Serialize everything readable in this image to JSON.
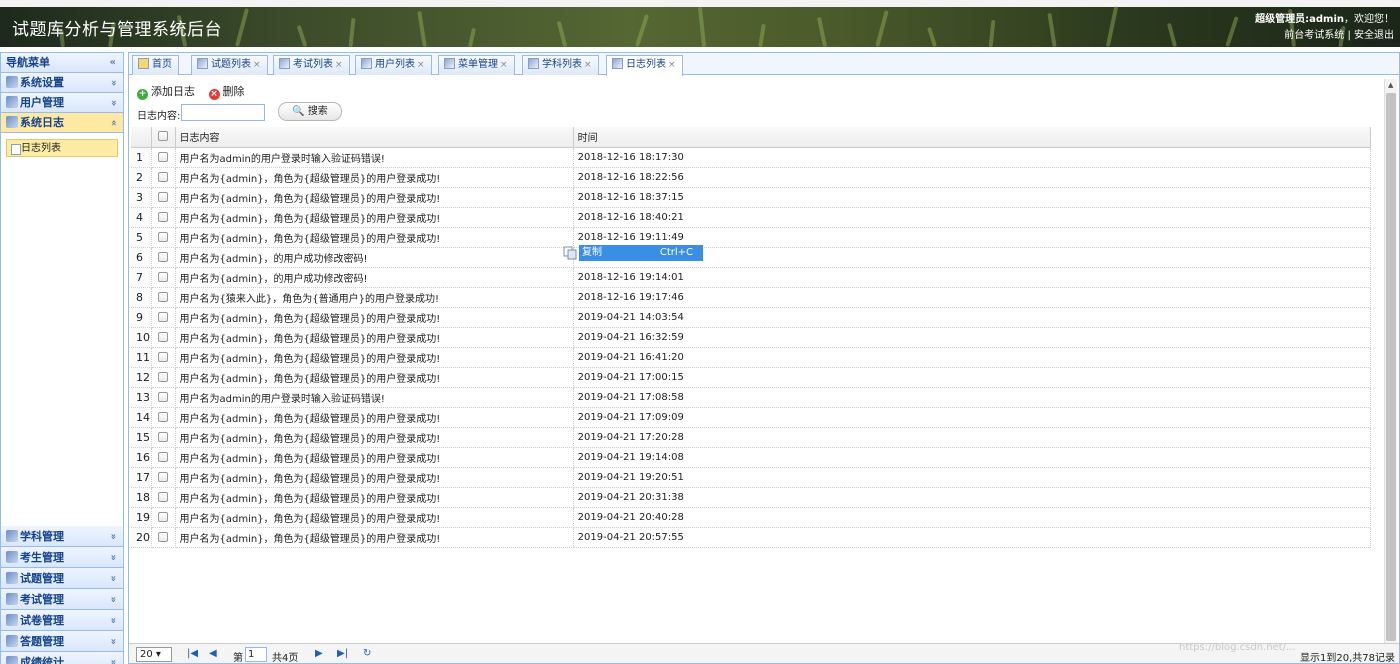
{
  "header": {
    "title": "试题库分析与管理系统后台",
    "user_label": "超级管理员:admin",
    "welcome": "，欢迎您！",
    "front_link": "前台考试系统",
    "separator": "|",
    "logout_link": "安全退出"
  },
  "sidebar": {
    "title": "导航菜单",
    "collapse_icon": "«",
    "groups_top": [
      {
        "label": "系统设置",
        "icon": "tools-icon",
        "arrow": "»"
      },
      {
        "label": "用户管理",
        "icon": "users-icon",
        "arrow": "»"
      },
      {
        "label": "系统日志",
        "icon": "log-icon",
        "arrow": "«",
        "active": true
      }
    ],
    "active_sub": "日志列表",
    "groups_bottom": [
      {
        "label": "学科管理",
        "icon": "list-icon"
      },
      {
        "label": "考生管理",
        "icon": "students-icon"
      },
      {
        "label": "试题管理",
        "icon": "calendar-icon"
      },
      {
        "label": "考试管理",
        "icon": "exam-icon"
      },
      {
        "label": "试卷管理",
        "icon": "paper-icon"
      },
      {
        "label": "答题管理",
        "icon": "answer-icon"
      },
      {
        "label": "成绩统计",
        "icon": "stats-icon"
      }
    ]
  },
  "tabs": [
    {
      "label": "首页",
      "closable": false
    },
    {
      "label": "试题列表",
      "closable": true
    },
    {
      "label": "考试列表",
      "closable": true
    },
    {
      "label": "用户列表",
      "closable": true
    },
    {
      "label": "菜单管理",
      "closable": true
    },
    {
      "label": "学科列表",
      "closable": true
    },
    {
      "label": "日志列表",
      "closable": true,
      "active": true
    }
  ],
  "toolbar": {
    "add_label": "添加日志",
    "delete_label": "删除"
  },
  "search": {
    "label": "日志内容:",
    "value": "",
    "button": "搜索"
  },
  "grid": {
    "columns": [
      "日志内容",
      "时间"
    ],
    "rows": [
      {
        "n": "1",
        "content": "用户名为admin的用户登录时输入验证码错误!",
        "time": "2018-12-16 18:17:30"
      },
      {
        "n": "2",
        "content": "用户名为{admin}，角色为{超级管理员}的用户登录成功!",
        "time": "2018-12-16 18:22:56"
      },
      {
        "n": "3",
        "content": "用户名为{admin}，角色为{超级管理员}的用户登录成功!",
        "time": "2018-12-16 18:37:15"
      },
      {
        "n": "4",
        "content": "用户名为{admin}，角色为{超级管理员}的用户登录成功!",
        "time": "2018-12-16 18:40:21"
      },
      {
        "n": "5",
        "content": "用户名为{admin}，角色为{超级管理员}的用户登录成功!",
        "time": "2018-12-16 19:11:49"
      },
      {
        "n": "6",
        "content": "用户名为{admin}，的用户成功修改密码!",
        "time": ""
      },
      {
        "n": "7",
        "content": "用户名为{admin}，的用户成功修改密码!",
        "time": "2018-12-16 19:14:01"
      },
      {
        "n": "8",
        "content": "用户名为{猿来入此}，角色为{普通用户}的用户登录成功!",
        "time": "2018-12-16 19:17:46"
      },
      {
        "n": "9",
        "content": "用户名为{admin}，角色为{超级管理员}的用户登录成功!",
        "time": "2019-04-21 14:03:54"
      },
      {
        "n": "10",
        "content": "用户名为{admin}，角色为{超级管理员}的用户登录成功!",
        "time": "2019-04-21 16:32:59"
      },
      {
        "n": "11",
        "content": "用户名为{admin}，角色为{超级管理员}的用户登录成功!",
        "time": "2019-04-21 16:41:20"
      },
      {
        "n": "12",
        "content": "用户名为{admin}，角色为{超级管理员}的用户登录成功!",
        "time": "2019-04-21 17:00:15"
      },
      {
        "n": "13",
        "content": "用户名为admin的用户登录时输入验证码错误!",
        "time": "2019-04-21 17:08:58"
      },
      {
        "n": "14",
        "content": "用户名为{admin}，角色为{超级管理员}的用户登录成功!",
        "time": "2019-04-21 17:09:09"
      },
      {
        "n": "15",
        "content": "用户名为{admin}，角色为{超级管理员}的用户登录成功!",
        "time": "2019-04-21 17:20:28"
      },
      {
        "n": "16",
        "content": "用户名为{admin}，角色为{超级管理员}的用户登录成功!",
        "time": "2019-04-21 19:14:08"
      },
      {
        "n": "17",
        "content": "用户名为{admin}，角色为{超级管理员}的用户登录成功!",
        "time": "2019-04-21 19:20:51"
      },
      {
        "n": "18",
        "content": "用户名为{admin}，角色为{超级管理员}的用户登录成功!",
        "time": "2019-04-21 20:31:38"
      },
      {
        "n": "19",
        "content": "用户名为{admin}，角色为{超级管理员}的用户登录成功!",
        "time": "2019-04-21 20:40:28"
      },
      {
        "n": "20",
        "content": "用户名为{admin}，角色为{超级管理员}的用户登录成功!",
        "time": "2019-04-21 20:57:55"
      }
    ]
  },
  "context_menu": {
    "label": "复制",
    "shortcut": "Ctrl+C"
  },
  "pager": {
    "page_size": "20",
    "page_prefix": "第",
    "page_value": "1",
    "page_total": "共4页",
    "info": "显示1到20,共78记录"
  },
  "watermark": "https://blog.csdn.net/..."
}
